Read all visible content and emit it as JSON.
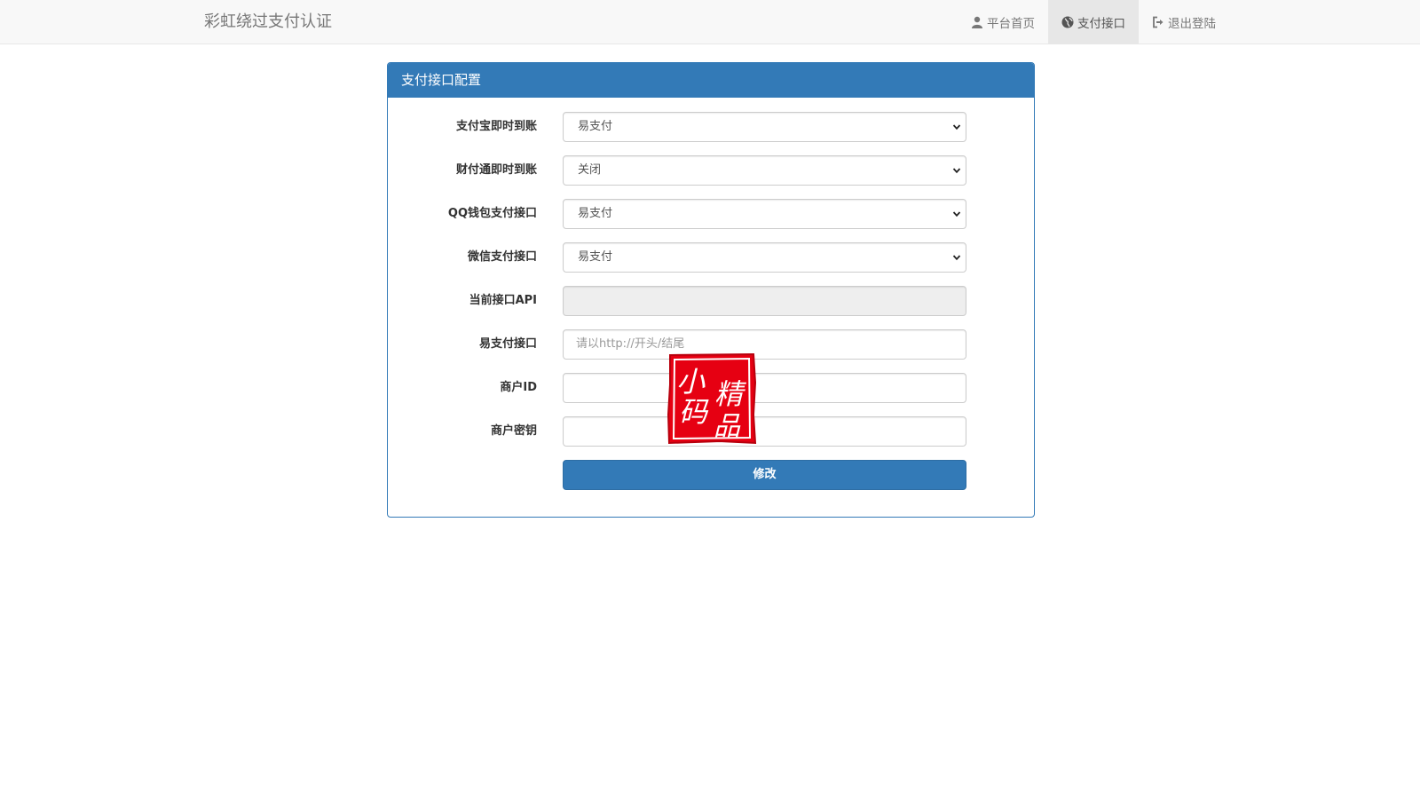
{
  "navbar": {
    "brand": "彩虹绕过支付认证",
    "items": [
      {
        "label": "平台首页",
        "icon": "user-icon",
        "active": false
      },
      {
        "label": "支付接口",
        "icon": "globe-icon",
        "active": true
      },
      {
        "label": "退出登陆",
        "icon": "sign-out-icon",
        "active": false
      }
    ]
  },
  "panel": {
    "title": "支付接口配置",
    "fields": [
      {
        "label": "支付宝即时到账",
        "type": "select",
        "value": "易支付"
      },
      {
        "label": "财付通即时到账",
        "type": "select",
        "value": "关闭"
      },
      {
        "label": "QQ钱包支付接口",
        "type": "select",
        "value": "易支付"
      },
      {
        "label": "微信支付接口",
        "type": "select",
        "value": "易支付"
      },
      {
        "label": "当前接口API",
        "type": "readonly",
        "value": ""
      },
      {
        "label": "易支付接口",
        "type": "input",
        "value": "",
        "placeholder": "请以http://开头/结尾"
      },
      {
        "label": "商户ID",
        "type": "input",
        "value": "",
        "placeholder": ""
      },
      {
        "label": "商户密钥",
        "type": "input",
        "value": "",
        "placeholder": ""
      }
    ],
    "submit_label": "修改"
  },
  "watermark": {
    "text": [
      "小",
      "精",
      "码",
      "品"
    ],
    "color": "#e60012"
  },
  "colors": {
    "primary": "#337ab7",
    "navbar_bg": "#f8f8f8"
  }
}
